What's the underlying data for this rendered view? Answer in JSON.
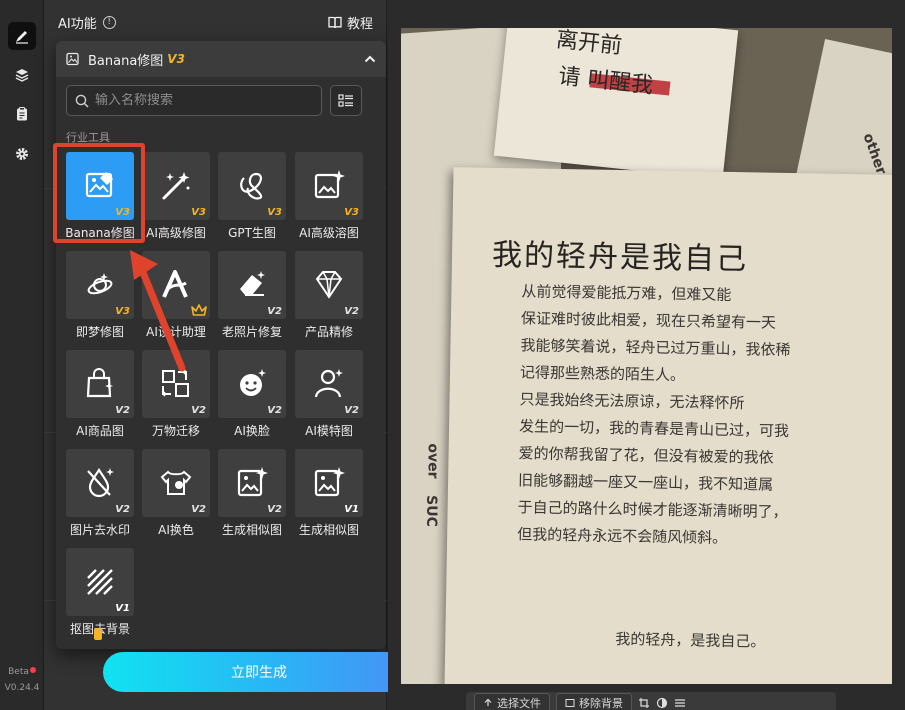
{
  "rail": {
    "items": [
      {
        "icon": "brush-icon",
        "active": true
      },
      {
        "icon": "layers-icon",
        "active": false
      },
      {
        "icon": "clipboard-icon",
        "active": false
      },
      {
        "icon": "gear-icon",
        "active": false
      }
    ],
    "beta": "Beta",
    "version": "V0.24.4"
  },
  "header": {
    "title": "AI功能",
    "tutorial_label": "教程"
  },
  "dropdown": {
    "selected_name": "Banana修图",
    "selected_version": "V3",
    "search_placeholder": "输入名称搜索",
    "section_label": "行业工具",
    "tools": [
      {
        "label": "Banana修图",
        "badge": "V3",
        "icon": "image-edit-icon",
        "selected": true
      },
      {
        "label": "AI高级修图",
        "badge": "V3",
        "icon": "magic-wand-icon"
      },
      {
        "label": "GPT生图",
        "badge": "V3",
        "icon": "knot-icon"
      },
      {
        "label": "AI高级溶图",
        "badge": "V3",
        "icon": "image-sparkle-icon"
      },
      {
        "label": "即梦修图",
        "badge": "V3",
        "icon": "dream-icon"
      },
      {
        "label": "AI设计助理",
        "badge": "",
        "icon": "design-a-icon",
        "crown": true
      },
      {
        "label": "老照片修复",
        "badge": "V2",
        "icon": "eraser-icon"
      },
      {
        "label": "产品精修",
        "badge": "V2",
        "icon": "diamond-icon"
      },
      {
        "label": "AI商品图",
        "badge": "V2",
        "icon": "shopping-bag-icon"
      },
      {
        "label": "万物迁移",
        "badge": "V2",
        "icon": "transfer-icon"
      },
      {
        "label": "AI换脸",
        "badge": "V2",
        "icon": "face-icon"
      },
      {
        "label": "AI模特图",
        "badge": "V2",
        "icon": "model-icon"
      },
      {
        "label": "图片去水印",
        "badge": "V2",
        "icon": "no-watermark-icon"
      },
      {
        "label": "AI换色",
        "badge": "V2",
        "icon": "tshirt-icon"
      },
      {
        "label": "生成相似图",
        "badge": "V2",
        "icon": "similar-image-icon"
      },
      {
        "label": "生成相似图",
        "badge": "V1",
        "icon": "similar-image-icon"
      },
      {
        "label": "抠图去背景",
        "badge": "V1",
        "icon": "cutout-icon"
      }
    ]
  },
  "generate_button": "立即生成",
  "canvas": {
    "card_title_1": "离开前",
    "card_title_2": "请 叫醒我",
    "letter_title": "我的轻舟是我自己",
    "letter_lines": [
      "从前觉得爱能抵万难，但难又能",
      "保证难时彼此相爱，现在只希望有一天",
      "我能够笑着说，轻舟已过万重山，我依稀",
      "记得那些熟悉的陌生人。",
      "只是我始终无法原谅，无法释怀所",
      "发生的一切，我的青春是青山已过，可我",
      "爱的你帮我留了花，但没有被爱的我依",
      "旧能够翻越一座又一座山，我不知道属",
      "于自己的路什么时候才能逐渐清晰明了，",
      "但我的轻舟永远不会随风倾斜。"
    ],
    "letter_sign": "我的轻舟，是我自己。",
    "bottom_buttons": [
      "选择文件",
      "移除背景"
    ]
  }
}
